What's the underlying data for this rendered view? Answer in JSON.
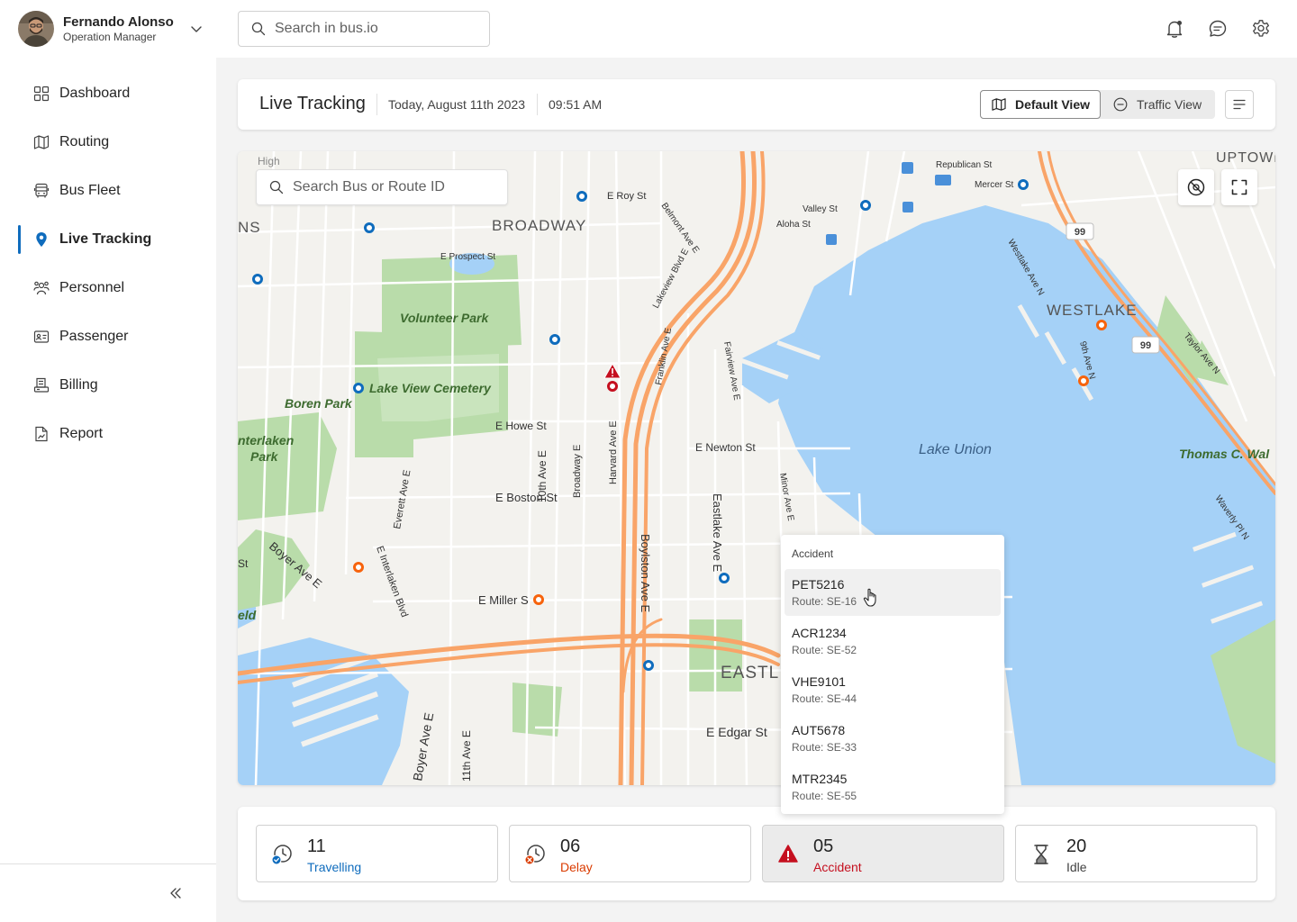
{
  "user": {
    "name": "Fernando Alonso",
    "role": "Operation Manager"
  },
  "search": {
    "placeholder": "Search in bus.io"
  },
  "nav": [
    {
      "label": "Dashboard",
      "icon": "grid-icon"
    },
    {
      "label": "Routing",
      "icon": "map-icon"
    },
    {
      "label": "Bus Fleet",
      "icon": "bus-icon"
    },
    {
      "label": "Live Tracking",
      "icon": "location-pin-icon",
      "active": true
    },
    {
      "label": "Personnel",
      "icon": "people-icon"
    },
    {
      "label": "Passenger",
      "icon": "id-card-icon"
    },
    {
      "label": "Billing",
      "icon": "receipt-icon"
    },
    {
      "label": "Report",
      "icon": "document-chart-icon"
    }
  ],
  "header": {
    "title": "Live Tracking",
    "date": "Today, August 11th 2023",
    "time": "09:51 AM",
    "default_view": "Default View",
    "traffic_view": "Traffic View"
  },
  "map": {
    "search_placeholder": "Search Bus or Route ID",
    "labels": {
      "broadway": "BROADWAY",
      "volunteer_park": "Volunteer Park",
      "lake_view_cemetery": "Lake View Cemetery",
      "boren_park": "Boren Park",
      "interlaken_park_1": "nterlaken",
      "interlaken_park_2": "Park",
      "lake_union": "Lake Union",
      "westlake": "WESTLAKE",
      "eastlake": "EASTL",
      "thomas": "Thomas C. Wal",
      "uptown": "UPTOWN",
      "high": "High",
      "ns": "NS",
      "eld": "eld",
      "st": "St",
      "e_boston": "E Boston St",
      "e_miller": "E Miller S",
      "e_howe": "E Howe St",
      "e_newton": "E Newton St",
      "e_edgar": "E Edgar St",
      "e_roy": "E Roy St",
      "e_prospect": "E Prospect St",
      "valley": "Valley St",
      "aloha": "Aloha St",
      "republican": "Republican St",
      "mercer": "Mercer St",
      "boylston": "Boylston Ave E",
      "eastlake_ave": "Eastlake Ave E",
      "harvard": "Harvard Ave E",
      "tenth": "10th Ave E",
      "eleventh": "11th Ave E",
      "boyer": "Boyer Ave E",
      "boyer_w": "Boyer Ave E",
      "broadway_e": "Broadway E",
      "everett": "Everett Ave E",
      "interlaken_blvd": "E Interlaken Blvd",
      "franklin": "Franklin Ave E",
      "fairview": "Fairview Ave E",
      "minor": "Minor Ave E",
      "lakeview": "Lakeview Blvd E",
      "belmont": "Belmont Ave E",
      "westlake_ave": "Westlake Ave N",
      "taylor": "Taylor Ave N",
      "waverly": "Waverly Pl N",
      "ninth": "9th Ave N",
      "route99a": "99",
      "route99b": "99"
    }
  },
  "accident_popup": {
    "title": "Accident",
    "items": [
      {
        "id": "PET5216",
        "route": "Route: SE-16"
      },
      {
        "id": "ACR1234",
        "route": "Route: SE-52"
      },
      {
        "id": "VHE9101",
        "route": "Route: SE-44"
      },
      {
        "id": "AUT5678",
        "route": "Route: SE-33"
      },
      {
        "id": "MTR2345",
        "route": "Route: SE-55"
      }
    ]
  },
  "stats": [
    {
      "value": "11",
      "label": "Travelling",
      "color": "#0f6cbd",
      "icon": "clock-check-icon"
    },
    {
      "value": "06",
      "label": "Delay",
      "color": "#da3b01",
      "icon": "clock-x-icon"
    },
    {
      "value": "05",
      "label": "Accident",
      "color": "#c50f1f",
      "icon": "warning-icon",
      "active": true
    },
    {
      "value": "20",
      "label": "Idle",
      "color": "#424242",
      "icon": "hourglass-icon"
    }
  ],
  "colors": {
    "accent": "#0f6cbd",
    "delay": "#f7630c",
    "accident": "#c50f1f",
    "water": "#a5d1f7",
    "park": "#b9dcaa",
    "highway": "#f9a468"
  }
}
